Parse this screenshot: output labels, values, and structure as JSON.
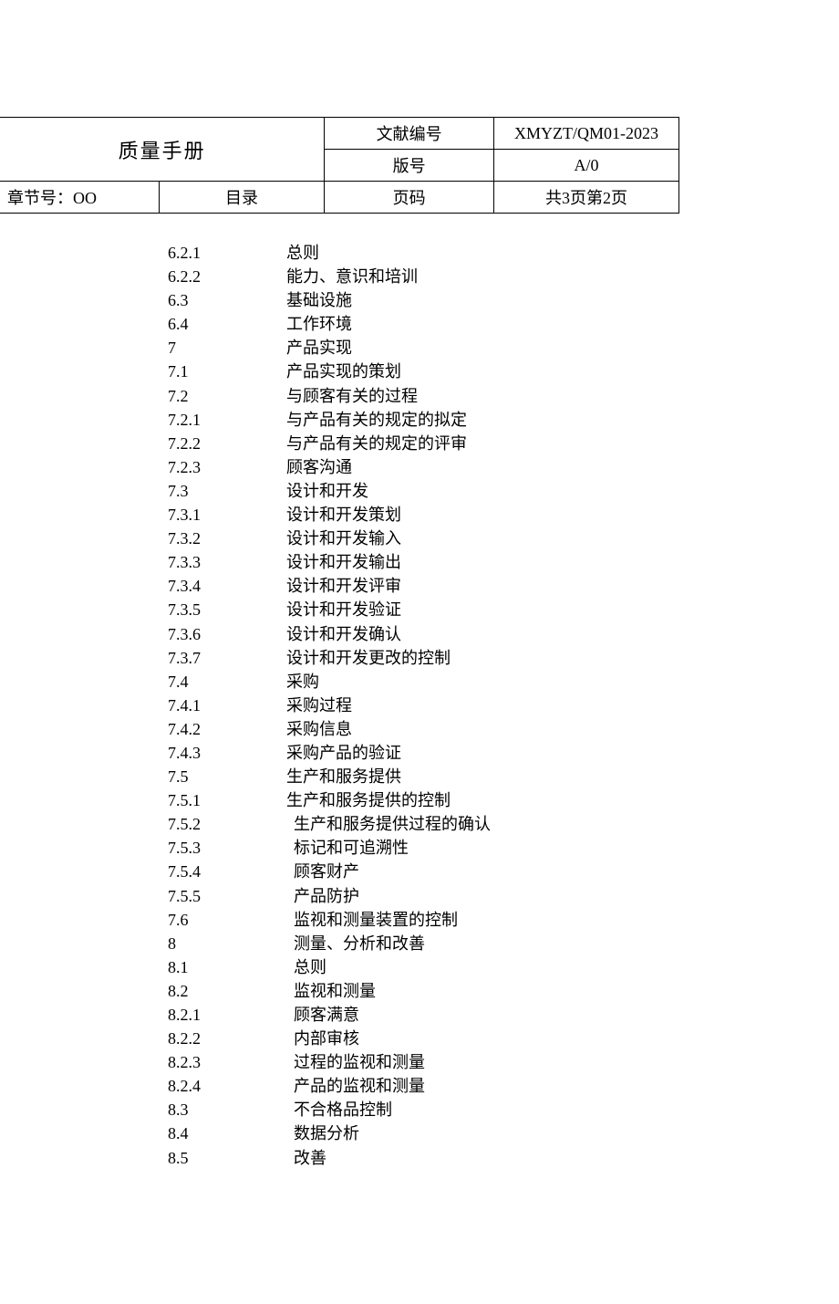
{
  "header": {
    "manual_title": "质量手册",
    "doc_no_label": "文献编号",
    "doc_no_value": "XMYZT/QM01-2023",
    "version_label": "版号",
    "version_value": "A/0",
    "chapter_label": "章节号：OO",
    "toc_label": "目录",
    "page_label": "页码",
    "page_value": "共3页第2页"
  },
  "toc": [
    {
      "num": "6.2.1",
      "title": "总则",
      "indent": 0
    },
    {
      "num": "6.2.2",
      "title": "能力、意识和培训",
      "indent": 0
    },
    {
      "num": "6.3",
      "title": "基础设施",
      "indent": 0
    },
    {
      "num": "6.4",
      "title": "工作环境",
      "indent": 0
    },
    {
      "num": "7",
      "title": "产品实现",
      "indent": 0
    },
    {
      "num": "7.1",
      "title": "产品实现的策划",
      "indent": 0
    },
    {
      "num": "7.2",
      "title": "与顾客有关的过程",
      "indent": 0
    },
    {
      "num": "7.2.1",
      "title": "与产品有关的规定的拟定",
      "indent": 0
    },
    {
      "num": "7.2.2",
      "title": "与产品有关的规定的评审",
      "indent": 0
    },
    {
      "num": "7.2.3",
      "title": "顾客沟通",
      "indent": 0
    },
    {
      "num": "7.3",
      "title": "设计和开发",
      "indent": 0
    },
    {
      "num": "7.3.1",
      "title": "设计和开发策划",
      "indent": 0
    },
    {
      "num": "7.3.2",
      "title": "设计和开发输入",
      "indent": 0
    },
    {
      "num": "7.3.3",
      "title": "设计和开发输出",
      "indent": 0
    },
    {
      "num": "7.3.4",
      "title": "设计和开发评审",
      "indent": 0
    },
    {
      "num": "7.3.5",
      "title": "设计和开发验证",
      "indent": 0
    },
    {
      "num": "7.3.6",
      "title": "设计和开发确认",
      "indent": 0
    },
    {
      "num": "7.3.7",
      "title": "设计和开发更改的控制",
      "indent": 0
    },
    {
      "num": "7.4",
      "title": "采购",
      "indent": 0
    },
    {
      "num": "7.4.1",
      "title": "采购过程",
      "indent": 0
    },
    {
      "num": "7.4.2",
      "title": "采购信息",
      "indent": 0
    },
    {
      "num": "7.4.3",
      "title": "采购产品的验证",
      "indent": 0
    },
    {
      "num": "7.5",
      "title": "生产和服务提供",
      "indent": 0
    },
    {
      "num": "7.5.1",
      "title": "生产和服务提供的控制",
      "indent": 0
    },
    {
      "num": "7.5.2",
      "title": "生产和服务提供过程的确认",
      "indent": 1
    },
    {
      "num": "7.5.3",
      "title": "标记和可追溯性",
      "indent": 1
    },
    {
      "num": "7.5.4",
      "title": "顾客财产",
      "indent": 1
    },
    {
      "num": "7.5.5",
      "title": "产品防护",
      "indent": 1
    },
    {
      "num": "7.6",
      "title": "监视和测量装置的控制",
      "indent": 1
    },
    {
      "num": "8",
      "title": "测量、分析和改善",
      "indent": 1
    },
    {
      "num": "8.1",
      "title": "总则",
      "indent": 1
    },
    {
      "num": "8.2",
      "title": "监视和测量",
      "indent": 1
    },
    {
      "num": "8.2.1",
      "title": "顾客满意",
      "indent": 1
    },
    {
      "num": "8.2.2",
      "title": "内部审核",
      "indent": 1
    },
    {
      "num": "8.2.3",
      "title": "过程的监视和测量",
      "indent": 1
    },
    {
      "num": "8.2.4",
      "title": "产品的监视和测量",
      "indent": 1
    },
    {
      "num": "8.3",
      "title": "不合格品控制",
      "indent": 1
    },
    {
      "num": "8.4",
      "title": "数据分析",
      "indent": 1
    },
    {
      "num": "8.5",
      "title": "改善",
      "indent": 1
    }
  ]
}
